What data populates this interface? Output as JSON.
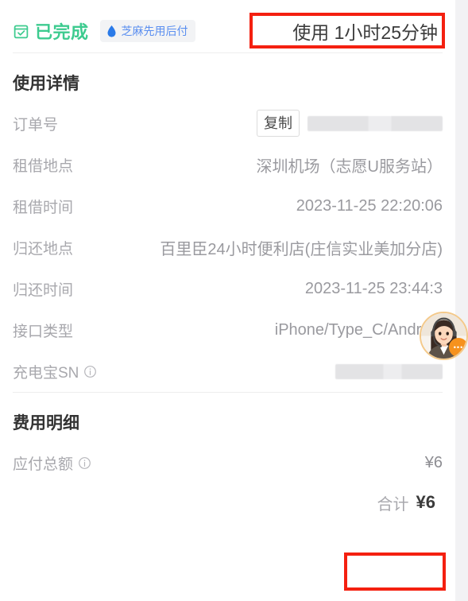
{
  "header": {
    "status_label": "已完成",
    "status_icon": "check-square-icon",
    "credit_badge": {
      "icon": "water-drop-icon",
      "label": "芝麻先用后付"
    },
    "duration_text": "使用 1小时25分钟",
    "highlight_color": "#f42010",
    "status_color": "#3dcb8f",
    "credit_color": "#5b8ff0"
  },
  "usage_section": {
    "title": "使用详情",
    "rows": [
      {
        "label": "订单号",
        "value": "",
        "redacted": true,
        "copy_label": "复制"
      },
      {
        "label": "租借地点",
        "value": "深圳机场（志愿U服务站）"
      },
      {
        "label": "租借时间",
        "value": "2023-11-25 22:20:06"
      },
      {
        "label": "归还地点",
        "value": "百里臣24小时便利店(庄信实业美加分店)"
      },
      {
        "label": "归还时间",
        "value": "2023-11-25 23:44:3"
      },
      {
        "label": "接口类型",
        "value": "iPhone/Type_C/Android"
      },
      {
        "label": "充电宝SN",
        "value": "",
        "redacted": true,
        "info_icon": "info-circle-icon"
      }
    ]
  },
  "fee_section": {
    "title": "费用明细",
    "rows": [
      {
        "label": "应付总额",
        "info_icon": "info-circle-icon",
        "value": "¥6"
      }
    ],
    "total": {
      "label": "合计",
      "value": "¥6"
    }
  },
  "service_widget": {
    "name": "customer-service-avatar",
    "badge_label": "•••"
  }
}
